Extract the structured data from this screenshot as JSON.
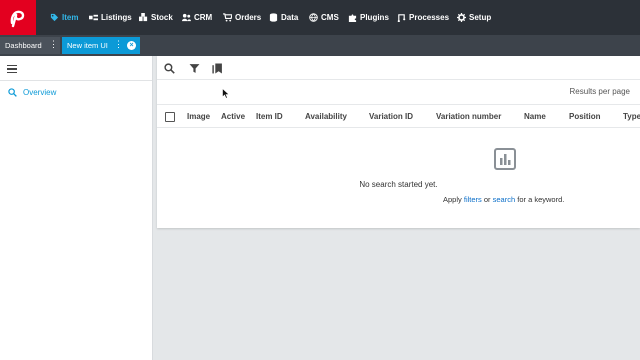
{
  "brand": {
    "accent": "#0c9ad7",
    "logo_bg": "#e3001f",
    "nav_bg": "#2c3138"
  },
  "nav": {
    "items": [
      {
        "label": "Item",
        "icon": "tag-icon",
        "active": true
      },
      {
        "label": "Listings",
        "icon": "listings-icon",
        "active": false
      },
      {
        "label": "Stock",
        "icon": "stock-icon",
        "active": false
      },
      {
        "label": "CRM",
        "icon": "people-icon",
        "active": false
      },
      {
        "label": "Orders",
        "icon": "cart-icon",
        "active": false
      },
      {
        "label": "Data",
        "icon": "database-icon",
        "active": false
      },
      {
        "label": "CMS",
        "icon": "globe-icon",
        "active": false
      },
      {
        "label": "Plugins",
        "icon": "puzzle-icon",
        "active": false
      },
      {
        "label": "Processes",
        "icon": "processes-icon",
        "active": false
      },
      {
        "label": "Setup",
        "icon": "gear-icon",
        "active": false
      }
    ]
  },
  "tabs": [
    {
      "label": "Dashboard"
    },
    {
      "label": "New item UI"
    }
  ],
  "sidebar": {
    "items": [
      {
        "label": "Overview",
        "icon": "search-icon"
      }
    ]
  },
  "toolbar": {
    "search_icon": "search-icon",
    "filter_icon": "filter-icon",
    "bookmarks_icon": "bookmarks-icon",
    "results_per_page": "Results per page"
  },
  "table": {
    "columns": [
      "Image",
      "Active",
      "Item ID",
      "Availability",
      "Variation ID",
      "Variation number",
      "Name",
      "Position",
      "Type"
    ]
  },
  "empty_state": {
    "icon": "chart-icon",
    "title": "No search started yet.",
    "hint_prefix": "Apply",
    "hint_link1": "filters",
    "hint_mid": "or",
    "hint_link2": "search",
    "hint_suffix": "for a keyword."
  }
}
